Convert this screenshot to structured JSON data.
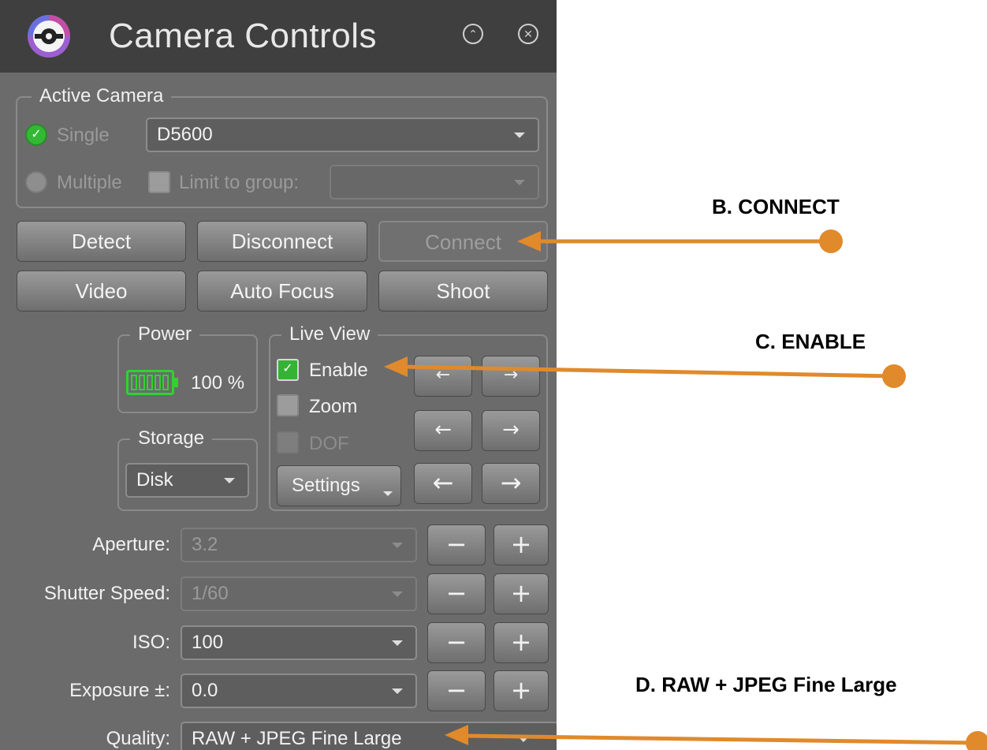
{
  "window": {
    "title": "Camera Controls",
    "minimize_icon": "chevron-up-circle-icon",
    "close_icon": "close-circle-icon"
  },
  "active_camera": {
    "group_label": "Active Camera",
    "single_label": "Single",
    "single_selected": true,
    "camera_value": "D5600",
    "multiple_label": "Multiple",
    "limit_label": "Limit to group:",
    "limit_value": ""
  },
  "buttons": {
    "detect": "Detect",
    "disconnect": "Disconnect",
    "connect": "Connect",
    "video": "Video",
    "auto_focus": "Auto Focus",
    "shoot": "Shoot"
  },
  "power": {
    "group_label": "Power",
    "value": "100 %",
    "level": 100
  },
  "storage": {
    "group_label": "Storage",
    "value": "Disk"
  },
  "live_view": {
    "group_label": "Live View",
    "enable_label": "Enable",
    "enable_checked": true,
    "zoom_label": "Zoom",
    "dof_label": "DOF",
    "settings_label": "Settings",
    "arrow_left": "←",
    "arrow_right": "→"
  },
  "settings": [
    {
      "label": "Aperture:",
      "value": "3.2",
      "enabled": false
    },
    {
      "label": "Shutter Speed:",
      "value": "1/60",
      "enabled": false
    },
    {
      "label": "ISO:",
      "value": "100",
      "enabled": true
    },
    {
      "label": "Exposure ±:",
      "value": "0.0",
      "enabled": true
    },
    {
      "label": "Quality:",
      "value": "RAW + JPEG Fine Large",
      "enabled": true
    }
  ],
  "stepper": {
    "minus": "−",
    "plus": "+"
  },
  "callouts": {
    "b": "B. CONNECT",
    "c": "C. ENABLE",
    "d": "D. RAW + JPEG Fine Large"
  },
  "colors": {
    "arrow": "#e08a2c",
    "check_green": "#34b334",
    "battery_green": "#2fd32f"
  }
}
